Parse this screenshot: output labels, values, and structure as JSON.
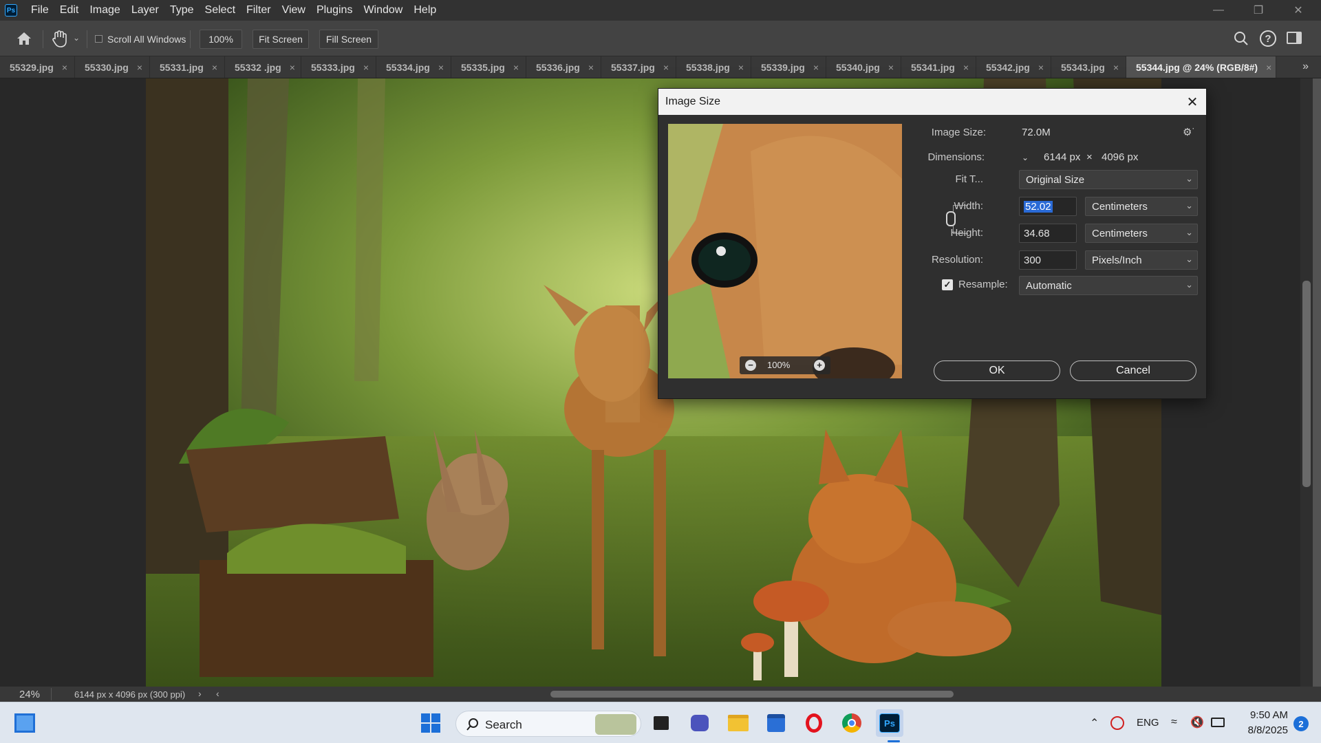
{
  "app": {
    "logo_text": "Ps",
    "menu": [
      "File",
      "Edit",
      "Image",
      "Layer",
      "Type",
      "Select",
      "Filter",
      "View",
      "Plugins",
      "Window",
      "Help"
    ]
  },
  "options": {
    "scroll_all_windows": "Scroll All Windows",
    "zoom_100": "100%",
    "fit_screen": "Fit Screen",
    "fill_screen": "Fill Screen"
  },
  "tabs": [
    {
      "label": "55329.jpg"
    },
    {
      "label": "55330.jpg"
    },
    {
      "label": "55331.jpg"
    },
    {
      "label": "55332 .jpg"
    },
    {
      "label": "55333.jpg"
    },
    {
      "label": "55334.jpg"
    },
    {
      "label": "55335.jpg"
    },
    {
      "label": "55336.jpg"
    },
    {
      "label": "55337.jpg"
    },
    {
      "label": "55338.jpg"
    },
    {
      "label": "55339.jpg"
    },
    {
      "label": "55340.jpg"
    },
    {
      "label": "55341.jpg"
    },
    {
      "label": "55342.jpg"
    },
    {
      "label": "55343.jpg"
    },
    {
      "label": "55344.jpg @ 24% (RGB/8#)",
      "active": true
    }
  ],
  "status": {
    "zoom": "24%",
    "doc_info": "6144 px x 4096 px (300 ppi)"
  },
  "dialog": {
    "title": "Image Size",
    "image_size_label": "Image Size:",
    "image_size_value": "72.0M",
    "dimensions_label": "Dimensions:",
    "dim_width": "6144 px",
    "dim_x": "×",
    "dim_height": "4096 px",
    "fit_label": "Fit T...",
    "fit_value": "Original Size",
    "width_label": "Width:",
    "width_value": "52.02",
    "width_unit": "Centimeters",
    "height_label": "Height:",
    "height_value": "34.68",
    "height_unit": "Centimeters",
    "resolution_label": "Resolution:",
    "resolution_value": "300",
    "resolution_unit": "Pixels/Inch",
    "resample_label": "Resample:",
    "resample_checked": true,
    "resample_value": "Automatic",
    "preview_zoom": "100%",
    "ok": "OK",
    "cancel": "Cancel"
  },
  "taskbar": {
    "search_label": "Search",
    "lang": "ENG",
    "time": "9:50 AM",
    "date": "8/8/2025",
    "notification_count": "2"
  }
}
